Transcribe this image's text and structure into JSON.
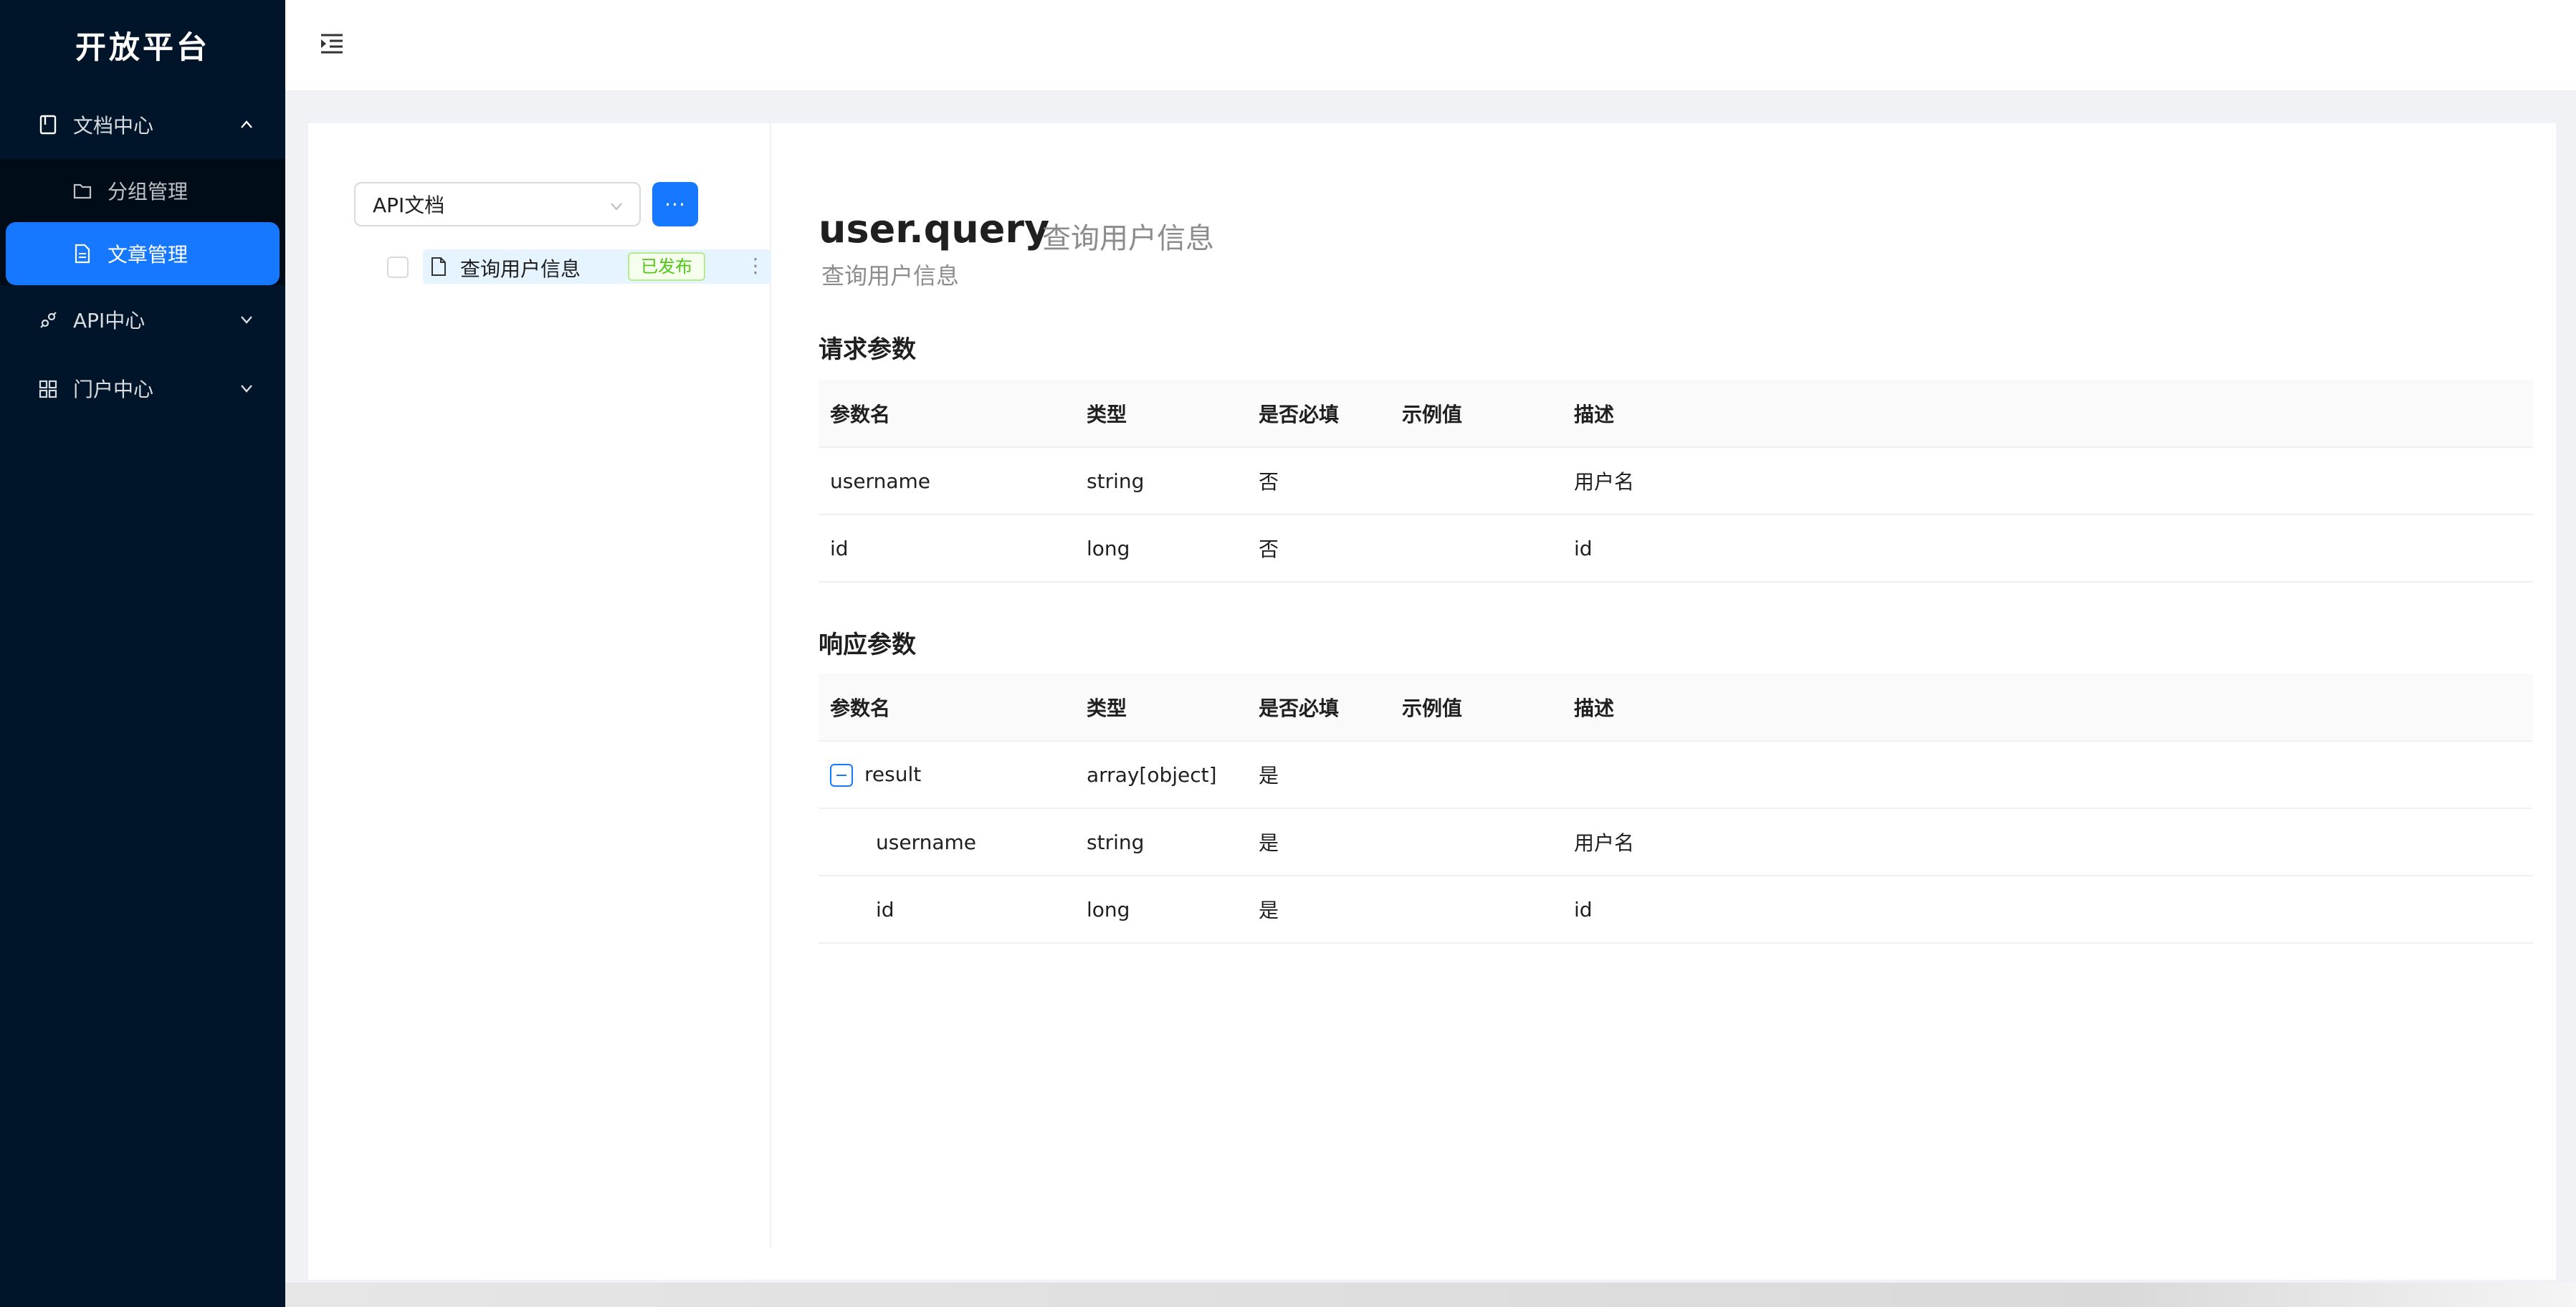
{
  "sidebar": {
    "logo": "开放平台",
    "menu": [
      {
        "label": "文档中心",
        "icon": "book-icon",
        "expanded": true,
        "children": [
          {
            "label": "分组管理",
            "icon": "folder-icon",
            "active": false
          },
          {
            "label": "文章管理",
            "icon": "file-icon",
            "active": true
          }
        ]
      },
      {
        "label": "API中心",
        "icon": "api-icon",
        "expanded": false
      },
      {
        "label": "门户中心",
        "icon": "appstore-icon",
        "expanded": false
      }
    ]
  },
  "header": {
    "fold_icon": "menu-fold-icon"
  },
  "left_panel": {
    "select_value": "API文档",
    "more_button": "···",
    "tree": [
      {
        "label": "查询用户信息",
        "status": "已发布",
        "icon": "file-icon"
      }
    ]
  },
  "doc": {
    "method": "user.query",
    "name": "查询用户信息",
    "description": "查询用户信息",
    "request_title": "请求参数",
    "response_title": "响应参数",
    "columns": [
      "参数名",
      "类型",
      "是否必填",
      "示例值",
      "描述"
    ],
    "request_rows": [
      {
        "name": "username",
        "type": "string",
        "required": "否",
        "example": "",
        "desc": "用户名"
      },
      {
        "name": "id",
        "type": "long",
        "required": "否",
        "example": "",
        "desc": "id"
      }
    ],
    "response_rows": [
      {
        "name": "result",
        "type": "array[object]",
        "required": "是",
        "example": "",
        "desc": ""
      },
      {
        "name": "username",
        "type": "string",
        "required": "是",
        "example": "",
        "desc": "用户名"
      },
      {
        "name": "id",
        "type": "long",
        "required": "是",
        "example": "",
        "desc": "id"
      }
    ]
  },
  "colors": {
    "sidebar_bg": "#001529",
    "primary": "#1677ff",
    "tag_green": "#52c41a"
  }
}
